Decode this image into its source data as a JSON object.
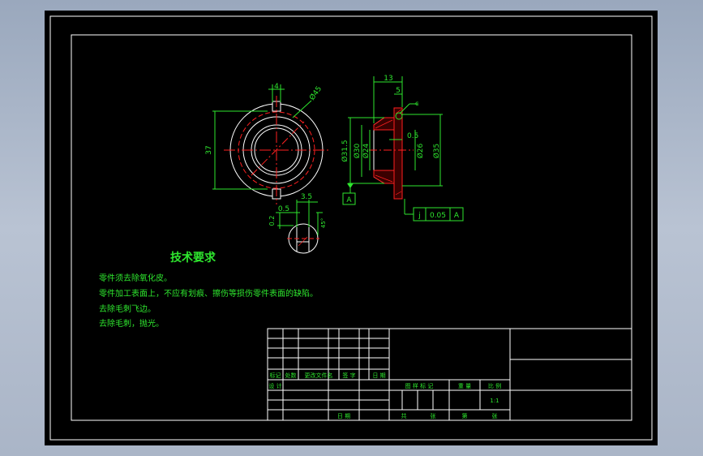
{
  "drawing": {
    "colors": {
      "paper": "#000000",
      "frame": "#ffffff",
      "geometry": "#ffffff",
      "annotation": "#2ee62e",
      "centerline": "#ff2020",
      "hatch": "#ff2020"
    },
    "front_view": {
      "dim_slot_width": "4",
      "dim_outer_diameter": "Ø45",
      "dim_height": "37"
    },
    "side_view": {
      "dim_width": "13",
      "dim_flange": "5",
      "dim_chamfer": "0.5",
      "dim_d1": "Ø31.5",
      "dim_d2": "Ø30",
      "dim_d3": "Ø24",
      "dim_d4": "Ø26",
      "dim_d5": "Ø35",
      "surface_mark": "c"
    },
    "datum": {
      "label": "A"
    },
    "tolerance": {
      "symbol": "j",
      "value": "0.05",
      "datum": "A"
    },
    "detail_view": {
      "dim_width": "3.5",
      "dim_chamfer": "0.5",
      "dim_depth": "0.2",
      "dim_angle": "45°"
    }
  },
  "tech_requirements": {
    "title": "技术要求",
    "lines": [
      "零件须去除氧化皮。",
      "零件加工表面上，不应有划痕、擦伤等损伤零件表面的缺陷。",
      "去除毛刺飞边。",
      "去除毛刺，抛光。"
    ]
  },
  "title_block": {
    "rev_headers": [
      "标记",
      "处数",
      "更改文件名",
      "签 字",
      "日 期"
    ],
    "design": "设 计",
    "date": "日 期",
    "stage_headers": [
      "图 样 标 记",
      "重 量",
      "比 例"
    ],
    "scale": "1:1",
    "sheet_labels": [
      "共",
      "张",
      "第",
      "张"
    ]
  }
}
